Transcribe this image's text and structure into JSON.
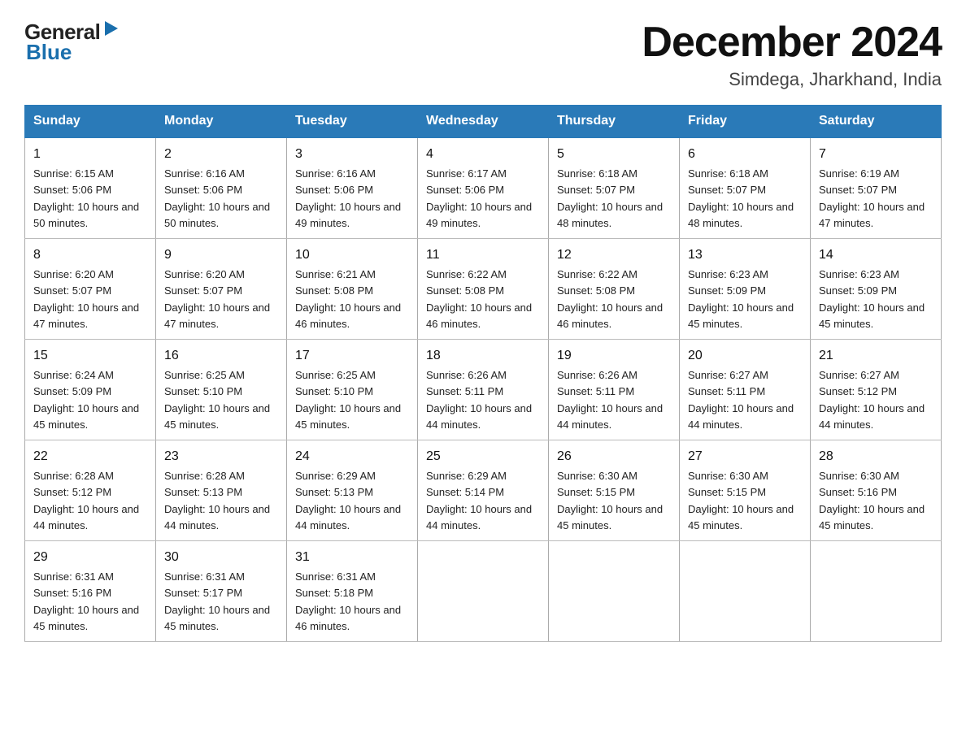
{
  "logo": {
    "general": "General",
    "blue": "Blue"
  },
  "title": "December 2024",
  "subtitle": "Simdega, Jharkhand, India",
  "days_of_week": [
    "Sunday",
    "Monday",
    "Tuesday",
    "Wednesday",
    "Thursday",
    "Friday",
    "Saturday"
  ],
  "weeks": [
    [
      {
        "day": "1",
        "sunrise": "6:15 AM",
        "sunset": "5:06 PM",
        "daylight": "10 hours and 50 minutes."
      },
      {
        "day": "2",
        "sunrise": "6:16 AM",
        "sunset": "5:06 PM",
        "daylight": "10 hours and 50 minutes."
      },
      {
        "day": "3",
        "sunrise": "6:16 AM",
        "sunset": "5:06 PM",
        "daylight": "10 hours and 49 minutes."
      },
      {
        "day": "4",
        "sunrise": "6:17 AM",
        "sunset": "5:06 PM",
        "daylight": "10 hours and 49 minutes."
      },
      {
        "day": "5",
        "sunrise": "6:18 AM",
        "sunset": "5:07 PM",
        "daylight": "10 hours and 48 minutes."
      },
      {
        "day": "6",
        "sunrise": "6:18 AM",
        "sunset": "5:07 PM",
        "daylight": "10 hours and 48 minutes."
      },
      {
        "day": "7",
        "sunrise": "6:19 AM",
        "sunset": "5:07 PM",
        "daylight": "10 hours and 47 minutes."
      }
    ],
    [
      {
        "day": "8",
        "sunrise": "6:20 AM",
        "sunset": "5:07 PM",
        "daylight": "10 hours and 47 minutes."
      },
      {
        "day": "9",
        "sunrise": "6:20 AM",
        "sunset": "5:07 PM",
        "daylight": "10 hours and 47 minutes."
      },
      {
        "day": "10",
        "sunrise": "6:21 AM",
        "sunset": "5:08 PM",
        "daylight": "10 hours and 46 minutes."
      },
      {
        "day": "11",
        "sunrise": "6:22 AM",
        "sunset": "5:08 PM",
        "daylight": "10 hours and 46 minutes."
      },
      {
        "day": "12",
        "sunrise": "6:22 AM",
        "sunset": "5:08 PM",
        "daylight": "10 hours and 46 minutes."
      },
      {
        "day": "13",
        "sunrise": "6:23 AM",
        "sunset": "5:09 PM",
        "daylight": "10 hours and 45 minutes."
      },
      {
        "day": "14",
        "sunrise": "6:23 AM",
        "sunset": "5:09 PM",
        "daylight": "10 hours and 45 minutes."
      }
    ],
    [
      {
        "day": "15",
        "sunrise": "6:24 AM",
        "sunset": "5:09 PM",
        "daylight": "10 hours and 45 minutes."
      },
      {
        "day": "16",
        "sunrise": "6:25 AM",
        "sunset": "5:10 PM",
        "daylight": "10 hours and 45 minutes."
      },
      {
        "day": "17",
        "sunrise": "6:25 AM",
        "sunset": "5:10 PM",
        "daylight": "10 hours and 45 minutes."
      },
      {
        "day": "18",
        "sunrise": "6:26 AM",
        "sunset": "5:11 PM",
        "daylight": "10 hours and 44 minutes."
      },
      {
        "day": "19",
        "sunrise": "6:26 AM",
        "sunset": "5:11 PM",
        "daylight": "10 hours and 44 minutes."
      },
      {
        "day": "20",
        "sunrise": "6:27 AM",
        "sunset": "5:11 PM",
        "daylight": "10 hours and 44 minutes."
      },
      {
        "day": "21",
        "sunrise": "6:27 AM",
        "sunset": "5:12 PM",
        "daylight": "10 hours and 44 minutes."
      }
    ],
    [
      {
        "day": "22",
        "sunrise": "6:28 AM",
        "sunset": "5:12 PM",
        "daylight": "10 hours and 44 minutes."
      },
      {
        "day": "23",
        "sunrise": "6:28 AM",
        "sunset": "5:13 PM",
        "daylight": "10 hours and 44 minutes."
      },
      {
        "day": "24",
        "sunrise": "6:29 AM",
        "sunset": "5:13 PM",
        "daylight": "10 hours and 44 minutes."
      },
      {
        "day": "25",
        "sunrise": "6:29 AM",
        "sunset": "5:14 PM",
        "daylight": "10 hours and 44 minutes."
      },
      {
        "day": "26",
        "sunrise": "6:30 AM",
        "sunset": "5:15 PM",
        "daylight": "10 hours and 45 minutes."
      },
      {
        "day": "27",
        "sunrise": "6:30 AM",
        "sunset": "5:15 PM",
        "daylight": "10 hours and 45 minutes."
      },
      {
        "day": "28",
        "sunrise": "6:30 AM",
        "sunset": "5:16 PM",
        "daylight": "10 hours and 45 minutes."
      }
    ],
    [
      {
        "day": "29",
        "sunrise": "6:31 AM",
        "sunset": "5:16 PM",
        "daylight": "10 hours and 45 minutes."
      },
      {
        "day": "30",
        "sunrise": "6:31 AM",
        "sunset": "5:17 PM",
        "daylight": "10 hours and 45 minutes."
      },
      {
        "day": "31",
        "sunrise": "6:31 AM",
        "sunset": "5:18 PM",
        "daylight": "10 hours and 46 minutes."
      },
      null,
      null,
      null,
      null
    ]
  ]
}
